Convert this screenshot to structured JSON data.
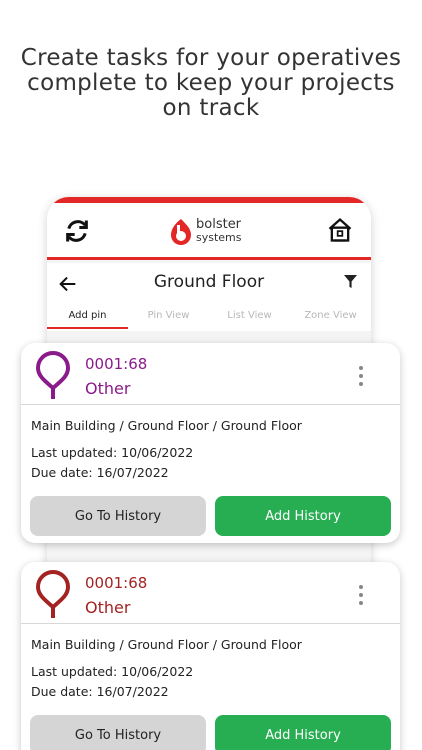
{
  "headline": {
    "line1": "Create tasks for your operatives",
    "line2": "complete to keep your projects",
    "line3": "on track"
  },
  "app": {
    "logo_line1": "bolster",
    "logo_line2": "systems",
    "nav_title": "Ground Floor",
    "tabs": [
      {
        "label": "Add pin",
        "active": true
      },
      {
        "label": "Pin View",
        "active": false
      },
      {
        "label": "List View",
        "active": false
      },
      {
        "label": "Zone View",
        "active": false
      }
    ],
    "brand_color": "#e32626"
  },
  "tasks": [
    {
      "id": "0001:68",
      "type": "Other",
      "color": "#8b1a8b",
      "path": "Main Building / Ground Floor / Ground Floor",
      "last_updated": "Last updated: 10/06/2022",
      "due_date": "Due date: 16/07/2022",
      "history_label": "Go To History",
      "add_label": "Add History"
    },
    {
      "id": "0001:68",
      "type": "Other",
      "color": "#a32222",
      "path": "Main Building / Ground Floor / Ground Floor",
      "last_updated": "Last updated: 10/06/2022",
      "due_date": "Due date: 16/07/2022",
      "history_label": "Go To History",
      "add_label": "Add History"
    }
  ]
}
